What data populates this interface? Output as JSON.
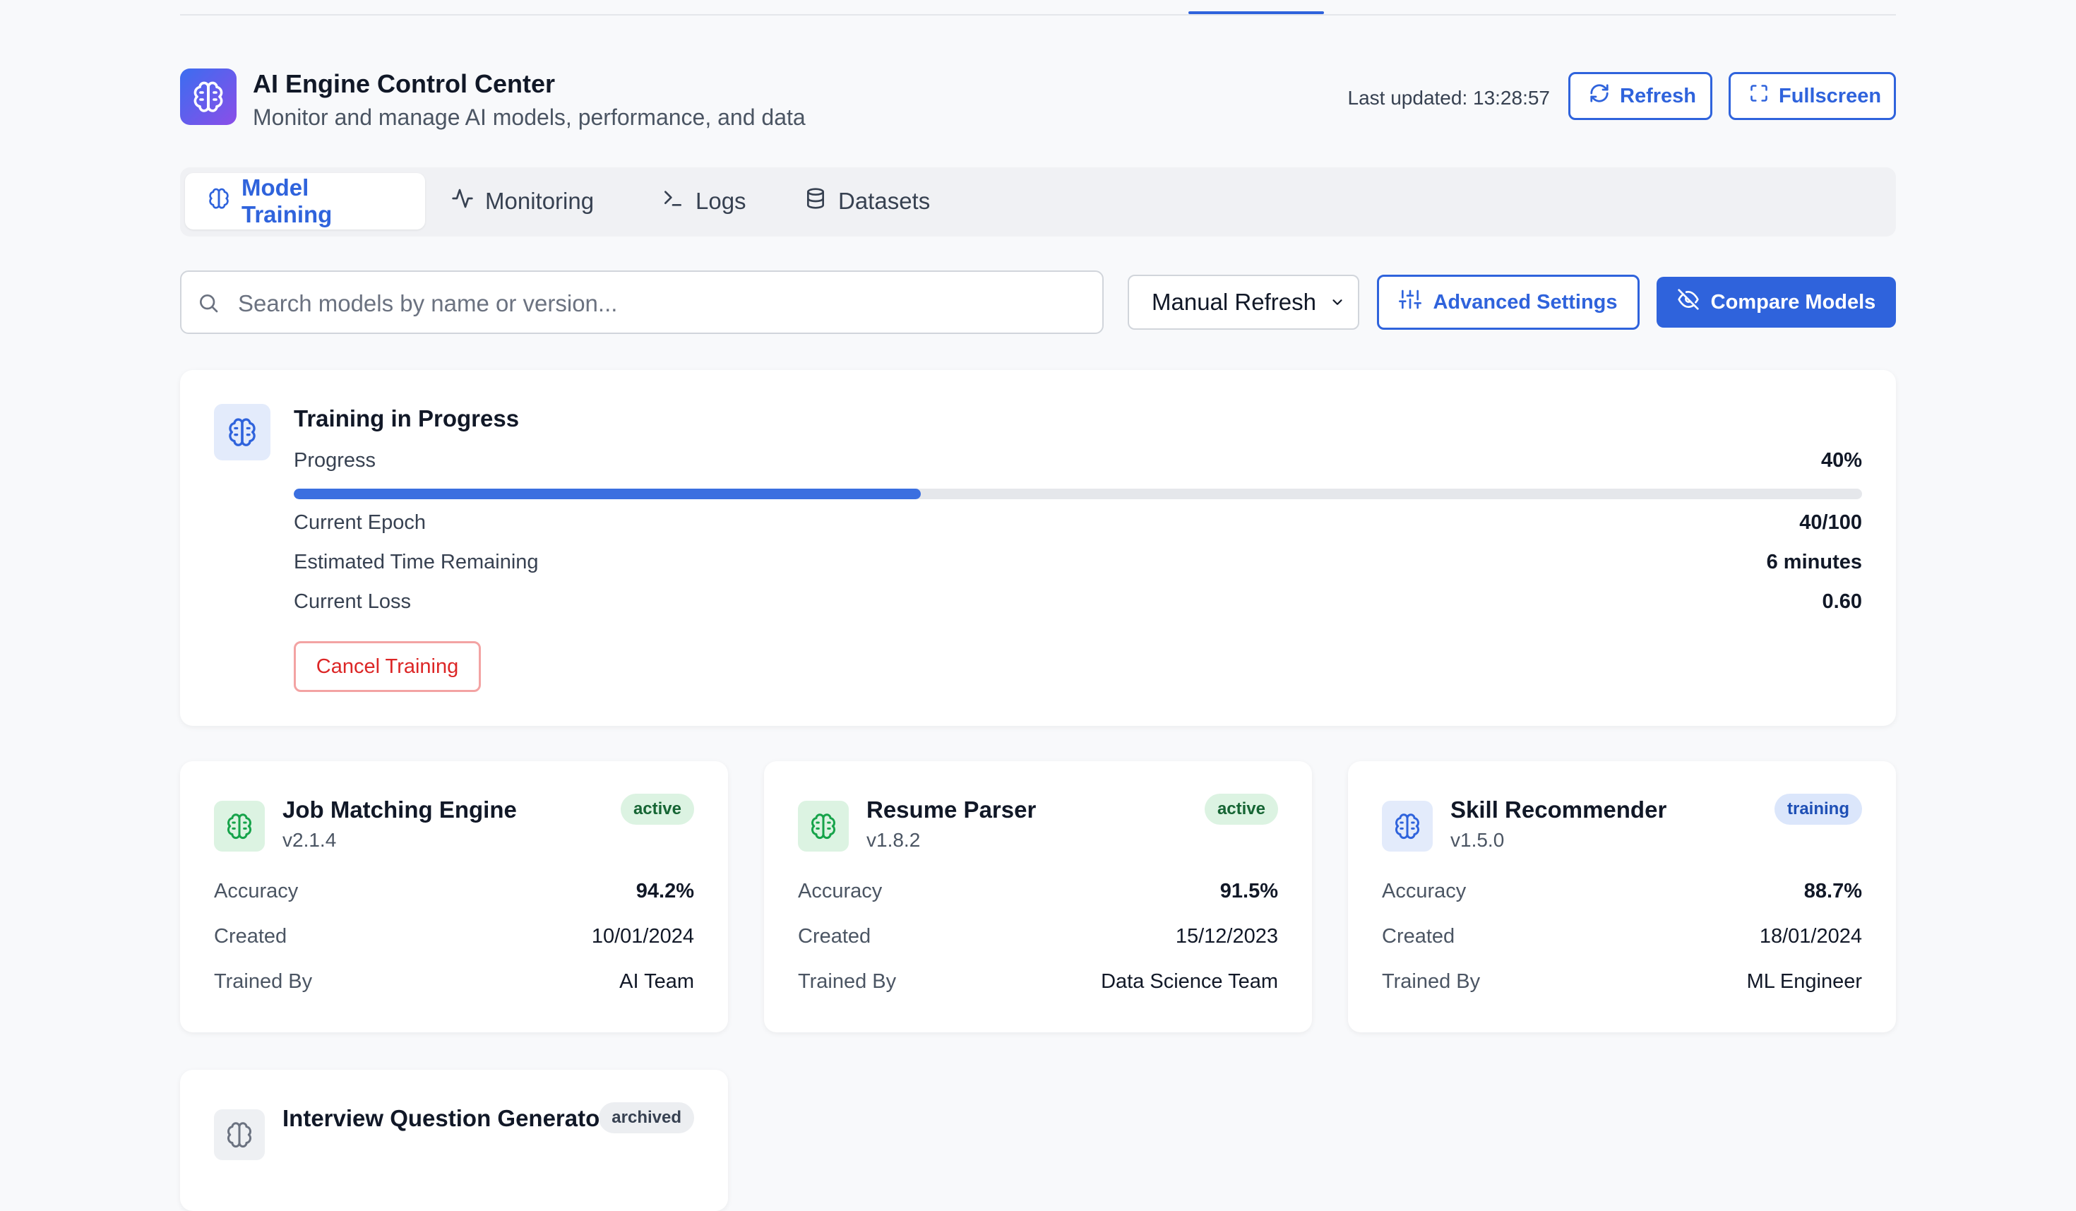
{
  "header": {
    "title": "AI Engine Control Center",
    "subtitle": "Monitor and manage AI models, performance, and data",
    "last_updated": "Last updated: 13:28:57",
    "refresh_label": "Refresh",
    "fullscreen_label": "Fullscreen"
  },
  "tabs": [
    {
      "label": "Model Training",
      "icon": "brain-icon",
      "active": true
    },
    {
      "label": "Monitoring",
      "icon": "activity-icon",
      "active": false
    },
    {
      "label": "Logs",
      "icon": "terminal-icon",
      "active": false
    },
    {
      "label": "Datasets",
      "icon": "database-icon",
      "active": false
    }
  ],
  "toolbar": {
    "search_placeholder": "Search models by name or version...",
    "search_value": "",
    "refresh_mode": "Manual Refresh",
    "advanced_settings_label": "Advanced Settings",
    "compare_models_label": "Compare Models"
  },
  "training": {
    "title": "Training in Progress",
    "progress_label": "Progress",
    "progress_value": "40%",
    "progress_fraction": 0.4,
    "epoch_label": "Current Epoch",
    "epoch_value": "40/100",
    "eta_label": "Estimated Time Remaining",
    "eta_value": "6 minutes",
    "loss_label": "Current Loss",
    "loss_value": "0.60",
    "cancel_label": "Cancel Training"
  },
  "models": [
    {
      "name": "Job Matching Engine",
      "version": "v2.1.4",
      "status": "active",
      "accuracy_label": "Accuracy",
      "accuracy": "94.2%",
      "created_label": "Created",
      "created": "10/01/2024",
      "trained_by_label": "Trained By",
      "trained_by": "AI Team"
    },
    {
      "name": "Resume Parser",
      "version": "v1.8.2",
      "status": "active",
      "accuracy_label": "Accuracy",
      "accuracy": "91.5%",
      "created_label": "Created",
      "created": "15/12/2023",
      "trained_by_label": "Trained By",
      "trained_by": "Data Science Team"
    },
    {
      "name": "Skill Recommender",
      "version": "v1.5.0",
      "status": "training",
      "accuracy_label": "Accuracy",
      "accuracy": "88.7%",
      "created_label": "Created",
      "created": "18/01/2024",
      "trained_by_label": "Trained By",
      "trained_by": "ML Engineer"
    },
    {
      "name": "Interview Question Generator",
      "status": "archived"
    }
  ],
  "colors": {
    "accent": "#2f63dc",
    "success": "#16a34a",
    "danger": "#dc2626",
    "background": "#f8f9fb"
  }
}
